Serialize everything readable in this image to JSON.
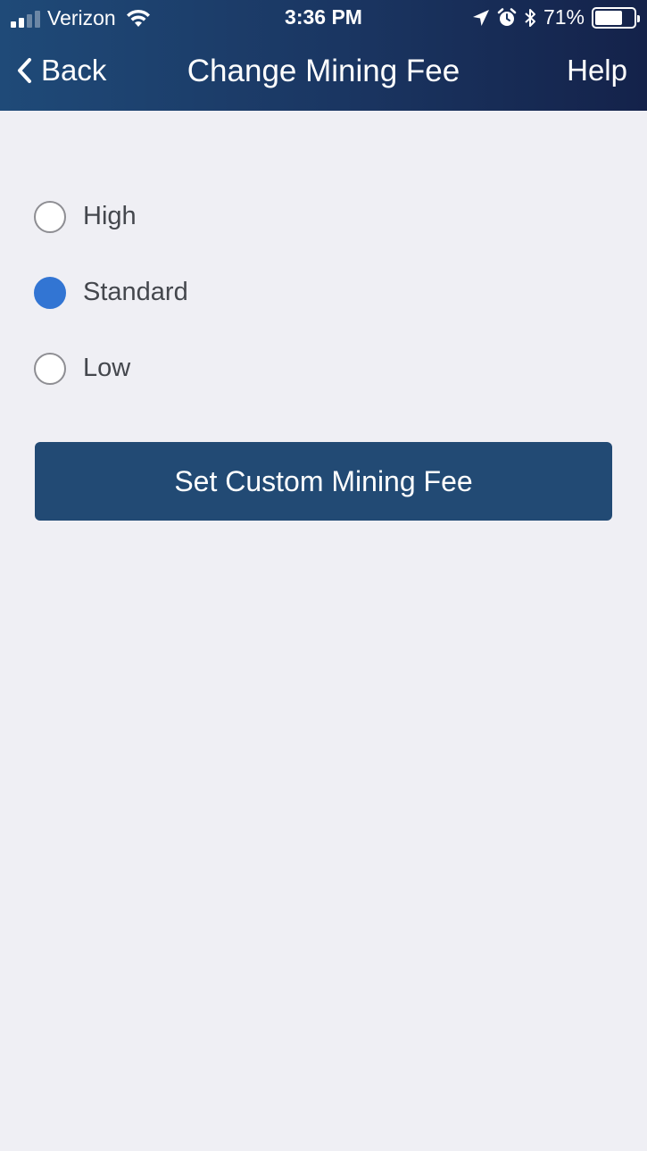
{
  "status_bar": {
    "carrier": "Verizon",
    "time": "3:36 PM",
    "battery_percent": "71%",
    "battery_level": 0.71,
    "icons": [
      "signal-icon",
      "wifi-icon",
      "location-arrow-icon",
      "alarm-icon",
      "bluetooth-icon",
      "battery-icon"
    ]
  },
  "nav": {
    "back_label": "Back",
    "title": "Change Mining Fee",
    "help_label": "Help"
  },
  "fee_options": [
    {
      "label": "High",
      "selected": false
    },
    {
      "label": "Standard",
      "selected": true
    },
    {
      "label": "Low",
      "selected": false
    }
  ],
  "custom_button_label": "Set Custom Mining Fee",
  "colors": {
    "header_start": "#1f4a78",
    "header_end": "#14224a",
    "radio_selected": "#3275d3",
    "button_bg": "#224a74",
    "page_bg": "#efeff4"
  }
}
